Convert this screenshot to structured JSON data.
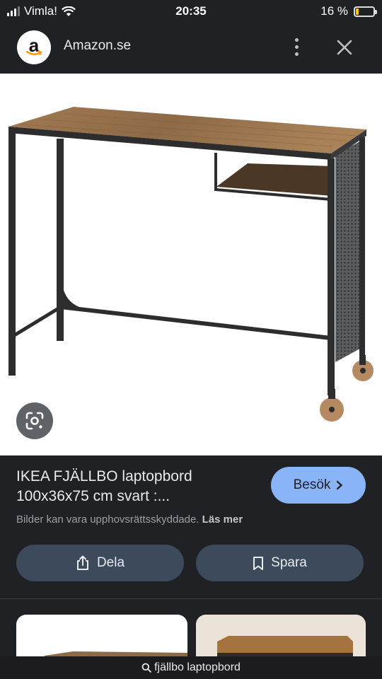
{
  "status_bar": {
    "carrier": "Vimla!",
    "time": "20:35",
    "battery_percent": "16 %",
    "battery_level": 0.16,
    "battery_color": "#f5c518"
  },
  "header": {
    "logo_letter": "a",
    "site_name": "Amazon.se",
    "icons": [
      "more-vertical-icon",
      "close-icon"
    ]
  },
  "image": {
    "subject": "IKEA FJÄLLBO laptop table",
    "lens_icon": "google-lens-icon"
  },
  "result": {
    "title": "IKEA FJÄLLBO laptopbord 100x36x75 cm svart :...",
    "visit_label": "Besök",
    "visit_color": "#8ab4f8",
    "notice": "Bilder kan vara upphovsrättsskyddade.",
    "read_more": "Läs mer"
  },
  "actions": {
    "share_label": "Dela",
    "save_label": "Spara",
    "button_color": "#3c4a5c"
  },
  "bottom_bar": {
    "query": "fjällbo laptopbord"
  }
}
